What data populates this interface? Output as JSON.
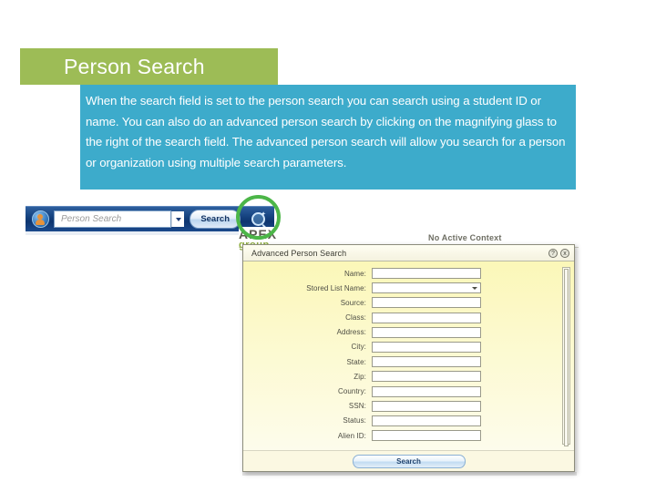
{
  "slide": {
    "title": "Person Search",
    "body": "When the search field is set to the person search you can search using a student ID or name. You can also do an advanced person search by clicking on the magnifying glass to the right of the search field. The advanced person search will allow you search for a person or organization using multiple search parameters.",
    "colors": {
      "title_background": "#9dbc56",
      "body_background": "#3dabcb",
      "title_text": "#ffffff",
      "body_text": "#ffffff",
      "highlight_ring": "#4cb648"
    }
  },
  "screenshot": {
    "toolbar": {
      "search_placeholder": "Person Search",
      "search_value": "",
      "search_button_label": "Search",
      "dropdown_caret": "chevron-down-icon",
      "magnifier": "magnifying-glass-icon",
      "avatar": "person-avatar-icon"
    },
    "branding": {
      "logo_word": "APEX",
      "logo_subword": "group"
    },
    "context_status": "No Active Context",
    "dialog": {
      "title": "Advanced Person Search",
      "titlebar_icons": [
        {
          "name": "help-icon",
          "glyph": "?"
        },
        {
          "name": "close-icon",
          "glyph": "x"
        }
      ],
      "fields": [
        {
          "label": "Name:",
          "value": "",
          "type": "text"
        },
        {
          "label": "Stored List Name:",
          "value": "",
          "type": "select"
        },
        {
          "label": "Source:",
          "value": "",
          "type": "text"
        },
        {
          "label": "Class:",
          "value": "",
          "type": "text"
        },
        {
          "label": "Address:",
          "value": "",
          "type": "text"
        },
        {
          "label": "City:",
          "value": "",
          "type": "text"
        },
        {
          "label": "State:",
          "value": "",
          "type": "text"
        },
        {
          "label": "Zip:",
          "value": "",
          "type": "text"
        },
        {
          "label": "Country:",
          "value": "",
          "type": "text"
        },
        {
          "label": "SSN:",
          "value": "",
          "type": "text"
        },
        {
          "label": "Status:",
          "value": "",
          "type": "text"
        },
        {
          "label": "Alien ID:",
          "value": "",
          "type": "text"
        }
      ],
      "submit_label": "Search"
    }
  }
}
